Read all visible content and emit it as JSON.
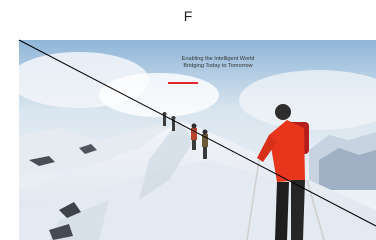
{
  "header": {
    "letter": "F"
  },
  "hero": {
    "tagline_line1": "Enabling the Intelligent World",
    "tagline_line2": "Bridging Today to Tomorrow",
    "accent_color": "#e3262e",
    "image_description_icon": "mountain-climbers-image"
  }
}
